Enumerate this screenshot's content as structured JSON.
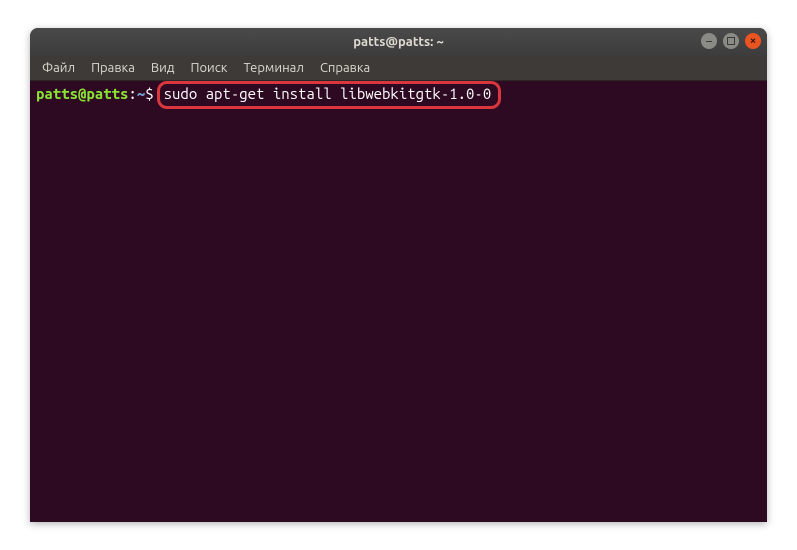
{
  "window": {
    "title": "patts@patts: ~"
  },
  "menubar": {
    "items": [
      {
        "label": "Файл"
      },
      {
        "label": "Правка"
      },
      {
        "label": "Вид"
      },
      {
        "label": "Поиск"
      },
      {
        "label": "Терминал"
      },
      {
        "label": "Справка"
      }
    ]
  },
  "terminal": {
    "prompt_user": "patts@patts",
    "prompt_colon": ":",
    "prompt_path": "~",
    "prompt_dollar": "$",
    "command": "sudo apt-get install libwebkitgtk-1.0-0"
  }
}
